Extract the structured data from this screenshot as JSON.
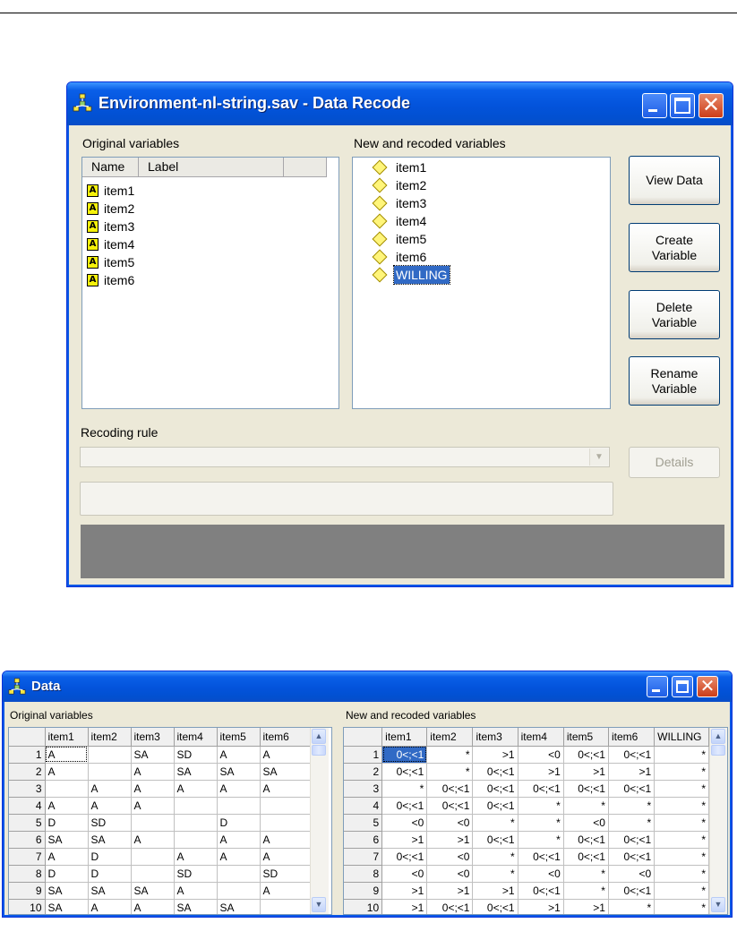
{
  "recode_window": {
    "title": "Environment-nl-string.sav - Data Recode",
    "icon": "network-icon",
    "original_label": "Original variables",
    "original_columns": [
      "Name",
      "Label"
    ],
    "original_items": [
      "item1",
      "item2",
      "item3",
      "item4",
      "item5",
      "item6"
    ],
    "new_label": "New and recoded variables",
    "new_items": [
      "item1",
      "item2",
      "item3",
      "item4",
      "item5",
      "item6",
      "WILLING"
    ],
    "selected_item": "WILLING",
    "buttons": {
      "view_data": "View Data",
      "create_variable": "Create Variable",
      "delete_variable": "Delete Variable",
      "rename_variable": "Rename Variable",
      "details": "Details"
    },
    "recoding_rule_label": "Recoding rule",
    "recoding_rule_value": "",
    "rule_text": ""
  },
  "data_window": {
    "title": "Data",
    "icon": "network-icon",
    "original_label": "Original variables",
    "new_label": "New and recoded variables",
    "original_table": {
      "columns": [
        "item1",
        "item2",
        "item3",
        "item4",
        "item5",
        "item6"
      ],
      "rows": [
        [
          "A",
          "",
          "SA",
          "SD",
          "A",
          "A"
        ],
        [
          "A",
          "",
          "A",
          "SA",
          "SA",
          "SA"
        ],
        [
          "",
          "A",
          "A",
          "A",
          "A",
          "A"
        ],
        [
          "A",
          "A",
          "A",
          "",
          "",
          ""
        ],
        [
          "D",
          "SD",
          "",
          "",
          "D",
          ""
        ],
        [
          "SA",
          "SA",
          "A",
          "",
          "A",
          "A"
        ],
        [
          "A",
          "D",
          "",
          "A",
          "A",
          "A"
        ],
        [
          "D",
          "D",
          "",
          "SD",
          "",
          "SD"
        ],
        [
          "SA",
          "SA",
          "SA",
          "A",
          "",
          "A"
        ],
        [
          "SA",
          "A",
          "A",
          "SA",
          "SA",
          ""
        ]
      ]
    },
    "new_table": {
      "columns": [
        "item1",
        "item2",
        "item3",
        "item4",
        "item5",
        "item6",
        "WILLING"
      ],
      "rows": [
        [
          "0<;<1",
          "*",
          ">1",
          "<0",
          "0<;<1",
          "0<;<1",
          "*"
        ],
        [
          "0<;<1",
          "*",
          "0<;<1",
          ">1",
          ">1",
          ">1",
          "*"
        ],
        [
          "*",
          "0<;<1",
          "0<;<1",
          "0<;<1",
          "0<;<1",
          "0<;<1",
          "*"
        ],
        [
          "0<;<1",
          "0<;<1",
          "0<;<1",
          "*",
          "*",
          "*",
          "*"
        ],
        [
          "<0",
          "<0",
          "*",
          "*",
          "<0",
          "*",
          "*"
        ],
        [
          ">1",
          ">1",
          "0<;<1",
          "*",
          "0<;<1",
          "0<;<1",
          "*"
        ],
        [
          "0<;<1",
          "<0",
          "*",
          "0<;<1",
          "0<;<1",
          "0<;<1",
          "*"
        ],
        [
          "<0",
          "<0",
          "*",
          "<0",
          "*",
          "<0",
          "*"
        ],
        [
          ">1",
          ">1",
          ">1",
          "0<;<1",
          "*",
          "0<;<1",
          "*"
        ],
        [
          ">1",
          "0<;<1",
          "0<;<1",
          ">1",
          ">1",
          "*",
          "*"
        ]
      ]
    }
  }
}
